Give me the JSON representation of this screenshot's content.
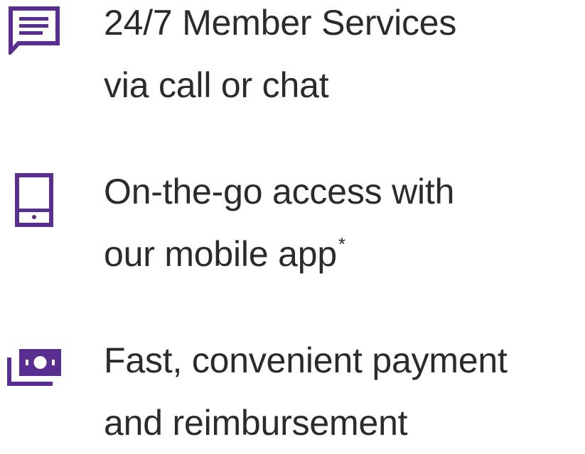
{
  "colors": {
    "accent": "#5a2d91",
    "text": "#2b2b2b"
  },
  "features": [
    {
      "icon": "chat-bubble-icon",
      "line1": "24/7 Member Services",
      "line2": "via call or chat",
      "footnote_mark": ""
    },
    {
      "icon": "mobile-phone-icon",
      "line1": "On-the-go access with",
      "line2": "our mobile app",
      "footnote_mark": "*"
    },
    {
      "icon": "money-bill-icon",
      "line1": "Fast, convenient payment",
      "line2": "and reimbursement",
      "footnote_mark": ""
    }
  ]
}
